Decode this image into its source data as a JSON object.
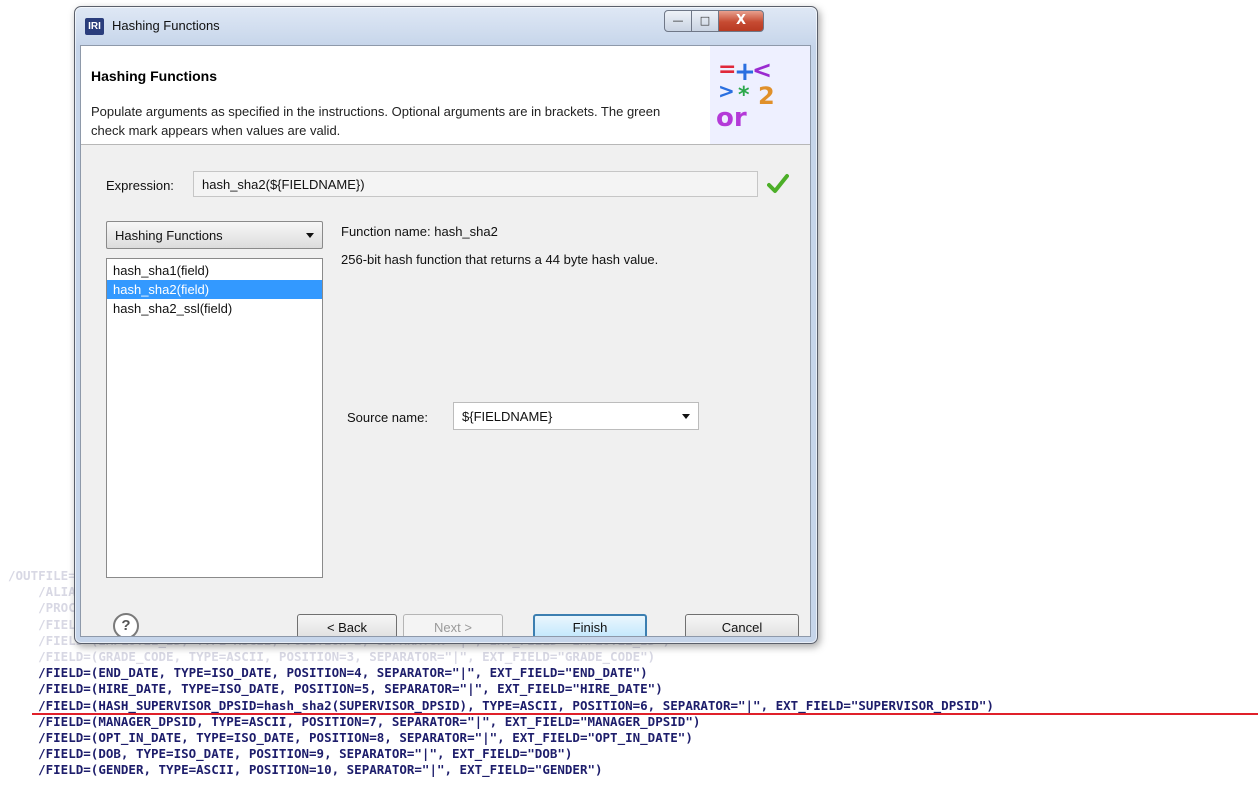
{
  "window": {
    "app_logo_text": "IRI",
    "title": "Hashing Functions",
    "min_glyph": "—",
    "max_glyph": "□",
    "close_glyph": "X"
  },
  "header": {
    "title": "Hashing Functions",
    "description": "Populate arguments as specified in the instructions. Optional arguments are in brackets. The green check mark appears when values are valid.",
    "logo_icon": "symbols-logo-icon",
    "logo_text": "or"
  },
  "expression": {
    "label": "Expression:",
    "value": "hash_sha2(${FIELDNAME})",
    "valid_icon": "check-icon",
    "valid_color": "#4caf28"
  },
  "category": {
    "selected": "Hashing Functions"
  },
  "functions": {
    "items": [
      "hash_sha1(field)",
      "hash_sha2(field)",
      "hash_sha2_ssl(field)"
    ],
    "selected_index": 1,
    "selected_color": "#3399ff"
  },
  "info": {
    "name_label": "Function name:",
    "name_value": "hash_sha2",
    "description": "256-bit hash function that returns a 44 byte hash value."
  },
  "source": {
    "label": "Source name:",
    "value": "${FIELDNAME}"
  },
  "buttons": {
    "help": "?",
    "back": "< Back",
    "next": "Next >",
    "finish": "Finish",
    "cancel": "Cancel"
  },
  "code": {
    "lines": [
      {
        "text": "/OUTFILE=SCOTT.EMPLOYEES.out",
        "faded": true,
        "indent": 0
      },
      {
        "text": "/ALIAS=SCOTT_EMPLOYEES",
        "faded": true,
        "indent": 1
      },
      {
        "text": "/PROCESS=RECORD",
        "faded": true,
        "indent": 1
      },
      {
        "text": "/FIELD=(DPSID, TYPE=ASCII, POSITION=1, SEPARATOR=\"|\", EXT_FIELD=\"DPSID\")",
        "faded": true,
        "indent": 1
      },
      {
        "text": "/FIELD=(EMPLOYEE_ID, TYPE=ASCII, POSITION=2, SEPARATOR=\"|\", EXT_FIELD=\"EMPLOYEE_ID\")",
        "faded": true,
        "indent": 1
      },
      {
        "text": "/FIELD=(GRADE_CODE, TYPE=ASCII, POSITION=3, SEPARATOR=\"|\", EXT_FIELD=\"GRADE_CODE\")",
        "faded": true,
        "indent": 1
      },
      {
        "text": "/FIELD=(END_DATE, TYPE=ISO_DATE, POSITION=4, SEPARATOR=\"|\", EXT_FIELD=\"END_DATE\")",
        "faded": false,
        "indent": 1
      },
      {
        "text": "/FIELD=(HIRE_DATE, TYPE=ISO_DATE, POSITION=5, SEPARATOR=\"|\", EXT_FIELD=\"HIRE_DATE\")",
        "faded": false,
        "indent": 1
      },
      {
        "text": "/FIELD=(HASH_SUPERVISOR_DPSID=hash_sha2(SUPERVISOR_DPSID), TYPE=ASCII, POSITION=6, SEPARATOR=\"|\", EXT_FIELD=\"SUPERVISOR_DPSID\")",
        "faded": false,
        "indent": 1,
        "highlight": true
      },
      {
        "text": "/FIELD=(MANAGER_DPSID, TYPE=ASCII, POSITION=7, SEPARATOR=\"|\", EXT_FIELD=\"MANAGER_DPSID\")",
        "faded": false,
        "indent": 1
      },
      {
        "text": "/FIELD=(OPT_IN_DATE, TYPE=ISO_DATE, POSITION=8, SEPARATOR=\"|\", EXT_FIELD=\"OPT_IN_DATE\")",
        "faded": false,
        "indent": 1
      },
      {
        "text": "/FIELD=(DOB, TYPE=ISO_DATE, POSITION=9, SEPARATOR=\"|\", EXT_FIELD=\"DOB\")",
        "faded": false,
        "indent": 1
      },
      {
        "text": "/FIELD=(GENDER, TYPE=ASCII, POSITION=10, SEPARATOR=\"|\", EXT_FIELD=\"GENDER\")",
        "faded": false,
        "indent": 1
      }
    ],
    "highlight_color": "#e0202a"
  }
}
